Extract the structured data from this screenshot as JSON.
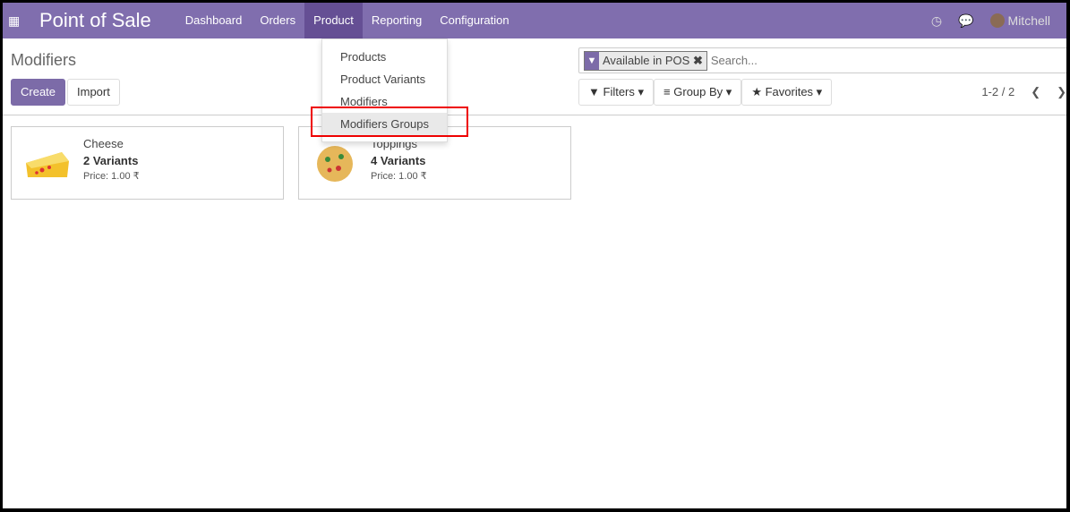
{
  "nav": {
    "app_title": "Point of Sale",
    "menu": [
      "Dashboard",
      "Orders",
      "Product",
      "Reporting",
      "Configuration"
    ],
    "user": "Mitchell"
  },
  "page": {
    "title": "Modifiers",
    "create": "Create",
    "import": "Import"
  },
  "search": {
    "facet": "Available in POS",
    "placeholder": "Search...",
    "filters": "Filters",
    "group_by": "Group By",
    "favorites": "Favorites",
    "pager": "1-2 / 2"
  },
  "dropdown": {
    "items": [
      "Products",
      "Product Variants",
      "Modifiers",
      "Modifiers Groups"
    ]
  },
  "cards": [
    {
      "name": "Cheese",
      "variants": "2 Variants",
      "price": "Price: 1.00 ₹"
    },
    {
      "name": "Toppings",
      "variants": "4 Variants",
      "price": "Price: 1.00 ₹"
    }
  ],
  "colors": {
    "brand": "#806eae",
    "highlight": "#ee0000"
  }
}
